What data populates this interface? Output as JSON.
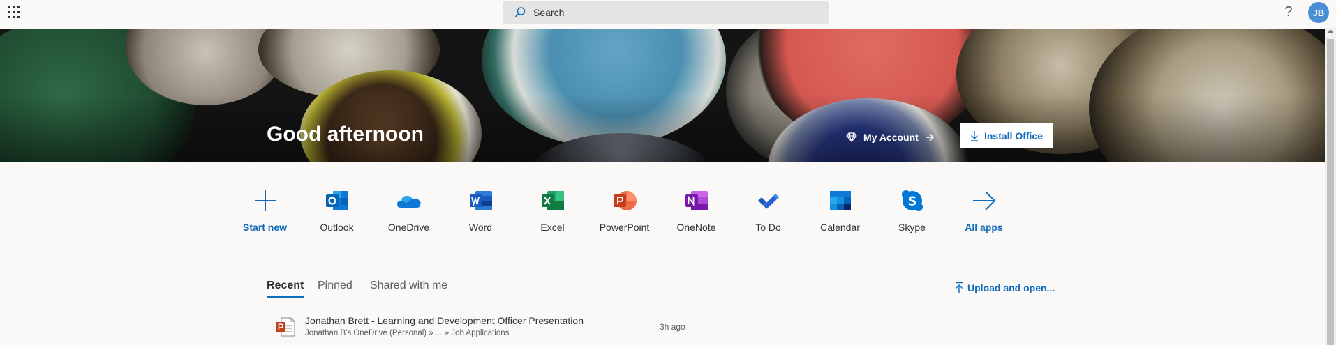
{
  "header": {
    "search_placeholder": "Search",
    "help_glyph": "?",
    "user_initials": "JB",
    "avatar_color": "#4a8fd4"
  },
  "hero": {
    "greeting": "Good afternoon",
    "my_account_label": "My Account",
    "install_office_label": "Install Office"
  },
  "apps": [
    {
      "label": "Start new",
      "icon": "plus-icon"
    },
    {
      "label": "Outlook",
      "icon": "outlook-icon"
    },
    {
      "label": "OneDrive",
      "icon": "onedrive-icon"
    },
    {
      "label": "Word",
      "icon": "word-icon"
    },
    {
      "label": "Excel",
      "icon": "excel-icon"
    },
    {
      "label": "PowerPoint",
      "icon": "powerpoint-icon"
    },
    {
      "label": "OneNote",
      "icon": "onenote-icon"
    },
    {
      "label": "To Do",
      "icon": "todo-icon"
    },
    {
      "label": "Calendar",
      "icon": "calendar-icon"
    },
    {
      "label": "Skype",
      "icon": "skype-icon"
    },
    {
      "label": "All apps",
      "icon": "arrow-right-icon"
    }
  ],
  "tabs": [
    {
      "label": "Recent",
      "active": true
    },
    {
      "label": "Pinned",
      "active": false
    },
    {
      "label": "Shared with me",
      "active": false
    }
  ],
  "upload_label": "Upload and open...",
  "files": [
    {
      "name": "Jonathan Brett - Learning and Development Officer Presentation",
      "path": "Jonathan B's OneDrive (Personal) » ... » Job Applications",
      "time": "3h ago",
      "icon": "powerpoint-file-icon"
    }
  ],
  "colors": {
    "accent": "#0f6cbd",
    "outlook": "#0364b8",
    "onedrive": "#0f78d4",
    "word": "#185abd",
    "excel": "#107c41",
    "powerpoint": "#c43e1c",
    "onenote": "#7719aa",
    "todo": "#2564cf",
    "skype": "#0078d4"
  }
}
